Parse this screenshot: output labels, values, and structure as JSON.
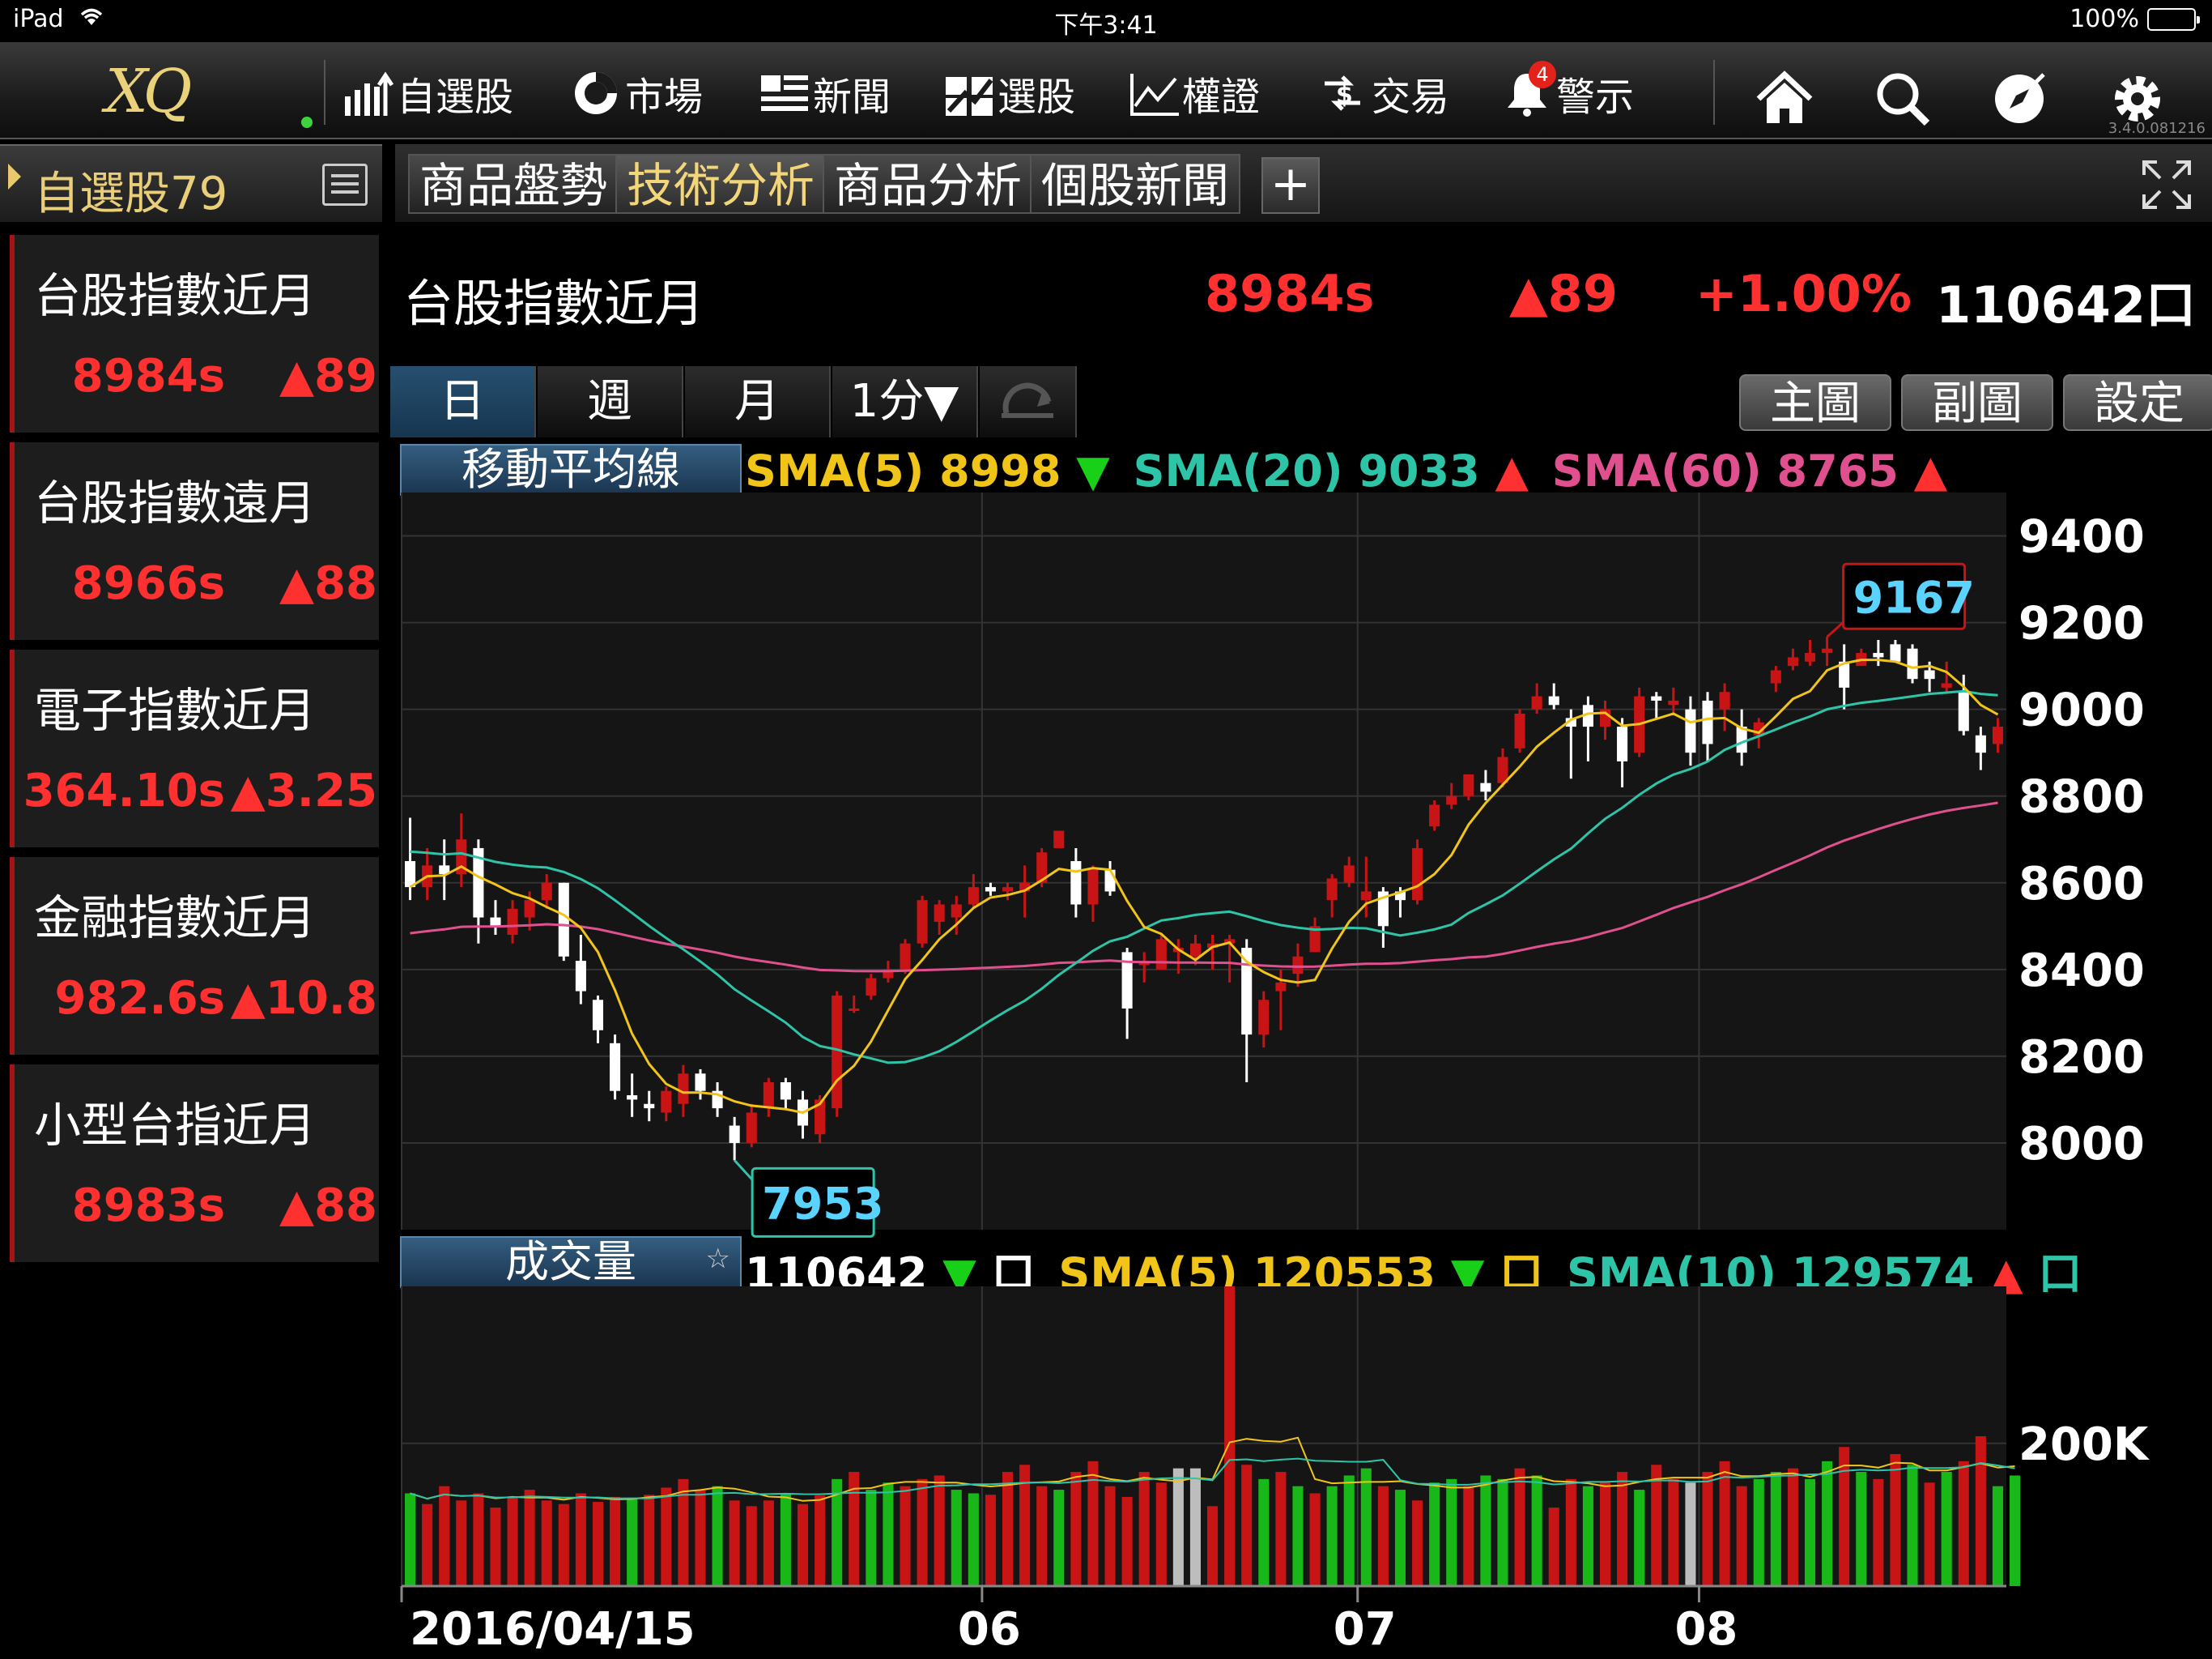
{
  "status_bar": {
    "device": "iPad",
    "time": "下午3:41",
    "battery": "100%"
  },
  "app": {
    "logo": "XQ",
    "version": "3.4.0.081216"
  },
  "nav": {
    "items": [
      {
        "label": "自選股",
        "icon": "bar-chart-icon"
      },
      {
        "label": "市場",
        "icon": "market-icon"
      },
      {
        "label": "新聞",
        "icon": "news-icon"
      },
      {
        "label": "選股",
        "icon": "stock-picker-icon"
      },
      {
        "label": "權證",
        "icon": "line-chart-icon"
      },
      {
        "label": "交易",
        "icon": "dollar-icon"
      },
      {
        "label": "警示",
        "icon": "bell-icon",
        "badge": "4"
      }
    ],
    "right_icons": [
      "home-icon",
      "search-icon",
      "compass-icon",
      "gear-icon"
    ]
  },
  "watchlist": {
    "title": "自選股79",
    "items": [
      {
        "name": "台股指數近月",
        "price": "8984s",
        "change": "▲89"
      },
      {
        "name": "台股指數遠月",
        "price": "8966s",
        "change": "▲88"
      },
      {
        "name": "電子指數近月",
        "price": "364.10s",
        "change": "▲3.25"
      },
      {
        "name": "金融指數近月",
        "price": "982.6s",
        "change": "▲10.8"
      },
      {
        "name": "小型台指近月",
        "price": "8983s",
        "change": "▲88"
      }
    ]
  },
  "tabs": [
    {
      "label": "商品盤勢",
      "active": false
    },
    {
      "label": "技術分析",
      "active": true
    },
    {
      "label": "商品分析",
      "active": false
    },
    {
      "label": "個股新聞",
      "active": false
    }
  ],
  "tab_add": "+",
  "quote": {
    "name": "台股指數近月",
    "price": "8984s",
    "change": "▲89",
    "percent": "+1.00%",
    "volume": "110642口"
  },
  "periods": [
    {
      "label": "日",
      "active": true
    },
    {
      "label": "週",
      "active": false
    },
    {
      "label": "月",
      "active": false
    },
    {
      "label": "1分▼",
      "active": false
    }
  ],
  "chart_buttons": [
    "主圖",
    "副圖",
    "設定"
  ],
  "indicators": {
    "price_label": "移動平均線",
    "sma5": "SMA(5) 8998",
    "sma5_dir": "▼",
    "sma20": "SMA(20) 9033",
    "sma20_dir": "▲",
    "sma60": "SMA(60) 8765",
    "sma60_dir": "▲",
    "volume_label": "成交量",
    "volume_star": "☆",
    "vol": "110642",
    "vol_dir": "▼",
    "vol_unit": "口",
    "vol_sma5": "SMA(5) 120553",
    "vol_sma5_dir": "▼",
    "vol_sma10": "SMA(10) 129574",
    "vol_sma10_dir": "▲"
  },
  "colors": {
    "up": "#ff3030",
    "down": "#18d018",
    "sma5": "#f0c419",
    "sma20": "#2ec4a8",
    "sma60": "#e0508f",
    "accent_gold": "#e9cf7a"
  },
  "chart_data": [
    {
      "type": "candlestick",
      "y_axis_ticks": [
        "9400",
        "9200",
        "9000",
        "8800",
        "8600",
        "8400",
        "8200",
        "8000"
      ],
      "ylim": [
        7800,
        9500
      ],
      "x_tick_labels": [
        "2016/04/15",
        "06",
        "07",
        "08"
      ],
      "high_label": "9167",
      "low_label": "7953",
      "grid": true,
      "candles": [
        [
          8650,
          8750,
          8560,
          8590
        ],
        [
          8590,
          8680,
          8560,
          8640
        ],
        [
          8640,
          8700,
          8560,
          8620
        ],
        [
          8620,
          8760,
          8590,
          8700
        ],
        [
          8680,
          8700,
          8460,
          8520
        ],
        [
          8520,
          8560,
          8480,
          8500
        ],
        [
          8480,
          8560,
          8460,
          8540
        ],
        [
          8520,
          8580,
          8490,
          8560
        ],
        [
          8560,
          8620,
          8540,
          8600
        ],
        [
          8600,
          8600,
          8420,
          8430
        ],
        [
          8420,
          8480,
          8320,
          8350
        ],
        [
          8330,
          8340,
          8230,
          8260
        ],
        [
          8230,
          8250,
          8100,
          8120
        ],
        [
          8110,
          8160,
          8060,
          8100
        ],
        [
          8090,
          8120,
          8050,
          8080
        ],
        [
          8070,
          8130,
          8050,
          8120
        ],
        [
          8090,
          8180,
          8060,
          8160
        ],
        [
          8160,
          8170,
          8100,
          8120
        ],
        [
          8120,
          8140,
          8060,
          8080
        ],
        [
          8040,
          8060,
          7960,
          8000
        ],
        [
          8000,
          8090,
          7990,
          8070
        ],
        [
          8080,
          8150,
          8060,
          8140
        ],
        [
          8140,
          8150,
          8080,
          8100
        ],
        [
          8100,
          8120,
          8010,
          8040
        ],
        [
          8020,
          8110,
          8000,
          8100
        ],
        [
          8080,
          8350,
          8060,
          8340
        ],
        [
          8310,
          8340,
          8300,
          8310
        ],
        [
          8340,
          8390,
          8330,
          8380
        ],
        [
          8380,
          8420,
          8370,
          8400
        ],
        [
          8400,
          8470,
          8390,
          8460
        ],
        [
          8460,
          8570,
          8450,
          8560
        ],
        [
          8510,
          8560,
          8480,
          8550
        ],
        [
          8520,
          8570,
          8480,
          8550
        ],
        [
          8550,
          8620,
          8540,
          8590
        ],
        [
          8590,
          8600,
          8570,
          8580
        ],
        [
          8580,
          8600,
          8560,
          8590
        ],
        [
          8580,
          8640,
          8520,
          8600
        ],
        [
          8600,
          8680,
          8590,
          8670
        ],
        [
          8680,
          8720,
          8680,
          8720
        ],
        [
          8650,
          8680,
          8520,
          8550
        ],
        [
          8550,
          8640,
          8510,
          8630
        ],
        [
          8630,
          8650,
          8570,
          8580
        ],
        [
          8440,
          8450,
          8240,
          8310
        ],
        [
          8410,
          8440,
          8370,
          8420
        ],
        [
          8400,
          8480,
          8400,
          8470
        ],
        [
          8440,
          8470,
          8390,
          8450
        ],
        [
          8430,
          8480,
          8410,
          8460
        ],
        [
          8450,
          8480,
          8400,
          8460
        ],
        [
          8460,
          8480,
          8370,
          8470
        ],
        [
          8450,
          8470,
          8140,
          8250
        ],
        [
          8250,
          8350,
          8220,
          8330
        ],
        [
          8350,
          8400,
          8260,
          8370
        ],
        [
          8390,
          8460,
          8360,
          8430
        ],
        [
          8440,
          8520,
          8440,
          8500
        ],
        [
          8560,
          8620,
          8520,
          8610
        ],
        [
          8600,
          8660,
          8590,
          8640
        ],
        [
          8560,
          8660,
          8520,
          8580
        ],
        [
          8580,
          8590,
          8450,
          8500
        ],
        [
          8580,
          8590,
          8520,
          8560
        ],
        [
          8560,
          8700,
          8550,
          8680
        ],
        [
          8730,
          8790,
          8720,
          8780
        ],
        [
          8780,
          8830,
          8770,
          8800
        ],
        [
          8800,
          8850,
          8790,
          8850
        ],
        [
          8830,
          8860,
          8790,
          8810
        ],
        [
          8830,
          8910,
          8820,
          8890
        ],
        [
          8910,
          9000,
          8900,
          8990
        ],
        [
          9000,
          9060,
          8990,
          9030
        ],
        [
          9030,
          9060,
          9000,
          9010
        ],
        [
          8980,
          9000,
          8840,
          8960
        ],
        [
          9010,
          9030,
          8880,
          8960
        ],
        [
          8960,
          9020,
          8930,
          9000
        ],
        [
          8960,
          8980,
          8820,
          8880
        ],
        [
          8900,
          9050,
          8890,
          9030
        ],
        [
          9030,
          9040,
          8980,
          9020
        ],
        [
          9010,
          9050,
          8990,
          9020
        ],
        [
          9000,
          9030,
          8870,
          8900
        ],
        [
          9020,
          9040,
          8880,
          8920
        ],
        [
          9000,
          9060,
          8950,
          9040
        ],
        [
          8960,
          9000,
          8870,
          8900
        ],
        [
          8940,
          8980,
          8910,
          8970
        ],
        [
          9060,
          9100,
          9040,
          9090
        ],
        [
          9100,
          9140,
          9090,
          9120
        ],
        [
          9110,
          9160,
          9100,
          9130
        ],
        [
          9130,
          9167,
          9100,
          9140
        ],
        [
          9110,
          9150,
          9000,
          9050
        ],
        [
          9100,
          9140,
          9100,
          9130
        ],
        [
          9130,
          9160,
          9100,
          9120
        ],
        [
          9150,
          9160,
          9110,
          9110
        ],
        [
          9140,
          9150,
          9060,
          9070
        ],
        [
          9090,
          9110,
          9040,
          9070
        ],
        [
          9050,
          9110,
          9040,
          9060
        ],
        [
          9040,
          9080,
          8940,
          8950
        ],
        [
          8940,
          8960,
          8860,
          8900
        ],
        [
          8920,
          8980,
          8900,
          8960
        ]
      ]
    },
    {
      "type": "bar",
      "y_axis_ticks": [
        "200K"
      ],
      "ylim": [
        0,
        420000
      ],
      "volumes": [
        [
          130,
          1
        ],
        [
          115,
          0
        ],
        [
          140,
          0
        ],
        [
          120,
          0
        ],
        [
          130,
          0
        ],
        [
          110,
          0
        ],
        [
          125,
          0
        ],
        [
          135,
          0
        ],
        [
          120,
          0
        ],
        [
          115,
          0
        ],
        [
          130,
          0
        ],
        [
          118,
          0
        ],
        [
          125,
          0
        ],
        [
          122,
          1
        ],
        [
          128,
          0
        ],
        [
          138,
          0
        ],
        [
          150,
          0
        ],
        [
          135,
          0
        ],
        [
          140,
          1
        ],
        [
          120,
          0
        ],
        [
          112,
          0
        ],
        [
          120,
          0
        ],
        [
          130,
          1
        ],
        [
          115,
          0
        ],
        [
          127,
          0
        ],
        [
          150,
          1
        ],
        [
          160,
          0
        ],
        [
          135,
          1
        ],
        [
          145,
          1
        ],
        [
          140,
          0
        ],
        [
          150,
          0
        ],
        [
          155,
          0
        ],
        [
          135,
          1
        ],
        [
          130,
          1
        ],
        [
          128,
          0
        ],
        [
          160,
          0
        ],
        [
          170,
          0
        ],
        [
          140,
          0
        ],
        [
          135,
          1
        ],
        [
          160,
          0
        ],
        [
          175,
          0
        ],
        [
          140,
          0
        ],
        [
          125,
          0
        ],
        [
          160,
          0
        ],
        [
          145,
          0
        ],
        [
          165,
          2
        ],
        [
          165,
          2
        ],
        [
          112,
          0
        ],
        [
          420,
          0
        ],
        [
          170,
          0
        ],
        [
          150,
          1
        ],
        [
          160,
          0
        ],
        [
          140,
          1
        ],
        [
          130,
          0
        ],
        [
          140,
          1
        ],
        [
          155,
          1
        ],
        [
          165,
          1
        ],
        [
          140,
          0
        ],
        [
          135,
          1
        ],
        [
          120,
          0
        ],
        [
          145,
          1
        ],
        [
          150,
          1
        ],
        [
          140,
          0
        ],
        [
          155,
          1
        ],
        [
          150,
          1
        ],
        [
          165,
          0
        ],
        [
          155,
          1
        ],
        [
          110,
          0
        ],
        [
          150,
          0
        ],
        [
          140,
          1
        ],
        [
          145,
          0
        ],
        [
          160,
          0
        ],
        [
          135,
          1
        ],
        [
          170,
          0
        ],
        [
          150,
          0
        ],
        [
          145,
          2
        ],
        [
          160,
          0
        ],
        [
          175,
          0
        ],
        [
          140,
          0
        ],
        [
          150,
          1
        ],
        [
          160,
          1
        ],
        [
          165,
          0
        ],
        [
          150,
          1
        ],
        [
          175,
          1
        ],
        [
          195,
          0
        ],
        [
          160,
          1
        ],
        [
          150,
          0
        ],
        [
          185,
          0
        ],
        [
          170,
          1
        ],
        [
          145,
          0
        ],
        [
          160,
          1
        ],
        [
          175,
          0
        ],
        [
          210,
          0
        ],
        [
          140,
          1
        ],
        [
          155,
          1
        ]
      ]
    }
  ]
}
